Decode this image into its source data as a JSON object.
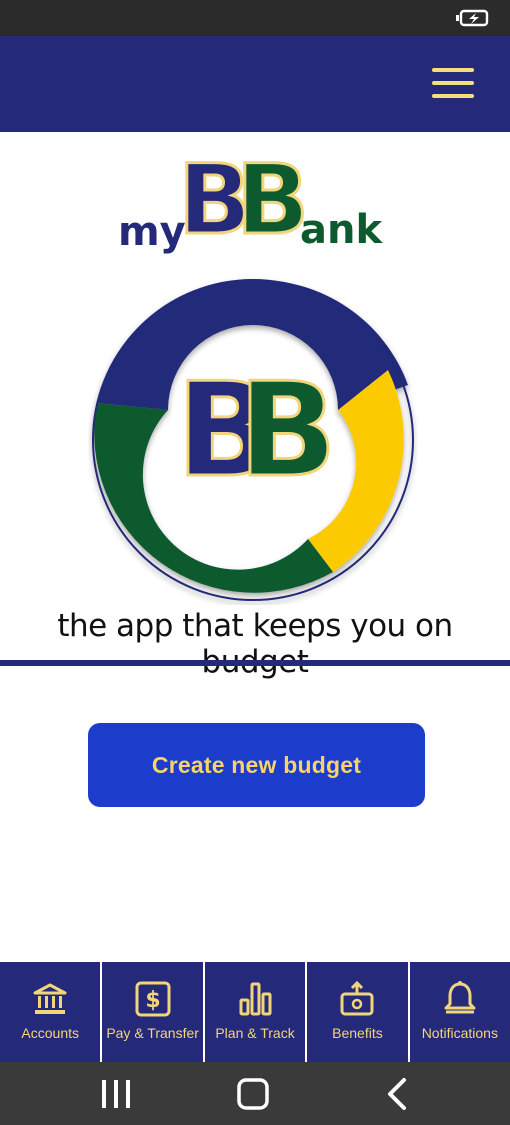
{
  "app": {
    "brand_prefix": "my",
    "brand_letters": "BB",
    "brand_suffix": "ank",
    "tagline": "the app that keeps you on budget",
    "colors": {
      "navy": "#24297a",
      "green": "#0c5a2e",
      "gold": "#f2d57a",
      "yellow": "#fcca05",
      "button_blue": "#1c3dcc"
    }
  },
  "status_bar": {
    "icon": "battery-charging-icon"
  },
  "header": {
    "menu_icon": "hamburger-menu-icon"
  },
  "main": {
    "create_button_label": "Create new budget"
  },
  "bottom_nav": {
    "items": [
      {
        "label": "Accounts",
        "icon": "bank-icon"
      },
      {
        "label": "Pay & Transfer",
        "icon": "money-transfer-icon"
      },
      {
        "label": "Plan & Track",
        "icon": "bar-chart-icon"
      },
      {
        "label": "Benefits",
        "icon": "gift-upload-icon"
      },
      {
        "label": "Notifications",
        "icon": "bell-icon"
      }
    ]
  },
  "system_nav": {
    "buttons": [
      "recents-icon",
      "home-icon",
      "back-icon"
    ]
  }
}
